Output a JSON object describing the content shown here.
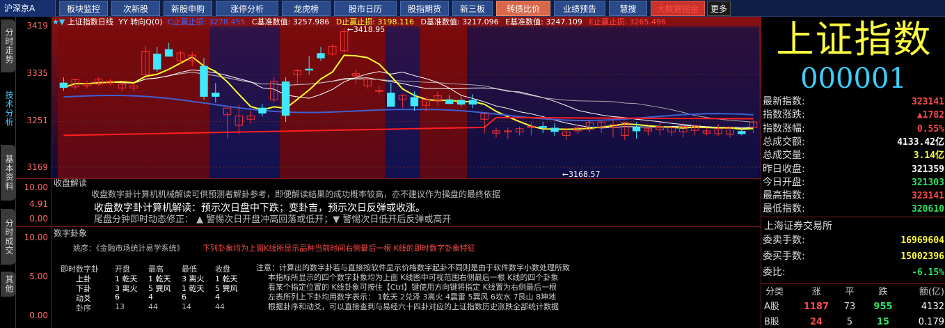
{
  "topbar": {
    "market": "沪深京A",
    "tabs": [
      "板块监控",
      "次新股",
      "新股申购",
      "涨停分析",
      "龙虎榜",
      "股市日历",
      "股指期货",
      "新三板",
      "转债比价",
      "业绩预告",
      "慧搜",
      "大数据掘金",
      "更多"
    ]
  },
  "leftbar": {
    "tabs": [
      "分时走势",
      "技术分析",
      "基本资料",
      "分时成交",
      "其他"
    ]
  },
  "chart": {
    "legend": {
      "title": "上证指数日线",
      "yy": "YY 转向Q(0)",
      "c_label": "C止赢止损:",
      "c_value": "3278.455",
      "c2_label": "C基准数值:",
      "c2_value": "3257.986",
      "d_label": "D止赢止损:",
      "d_value": "3198.116",
      "d2_label": "D基准数值:",
      "d2_value": "3217.096",
      "e_label": "E基准数值:",
      "e_value": "3247.109",
      "e2_label": "E止赢止损:",
      "e2_value": "3265.496"
    },
    "yticks": [
      "3419",
      "3335",
      "3251",
      "3169"
    ],
    "high_label": "3418.95",
    "low_label": "3168.57",
    "y_range": [
      3169,
      3419
    ]
  },
  "chart_data": {
    "type": "candlestick",
    "title": "上证指数日线",
    "ylim": [
      3169,
      3419
    ],
    "y_ticks": [
      3419,
      3335,
      3251,
      3169
    ],
    "annotations": [
      {
        "text": "3418.95",
        "value": 3418.95
      },
      {
        "text": "3168.57",
        "value": 3168.57
      }
    ],
    "candles": [
      {
        "o": 3320,
        "h": 3330,
        "l": 3306,
        "c": 3312
      },
      {
        "o": 3313,
        "h": 3328,
        "l": 3309,
        "c": 3326
      },
      {
        "o": 3315,
        "h": 3324,
        "l": 3310,
        "c": 3318
      },
      {
        "o": 3318,
        "h": 3330,
        "l": 3315,
        "c": 3327
      },
      {
        "o": 3320,
        "h": 3328,
        "l": 3316,
        "c": 3323
      },
      {
        "o": 3311,
        "h": 3322,
        "l": 3305,
        "c": 3318
      },
      {
        "o": 3311,
        "h": 3319,
        "l": 3305,
        "c": 3315
      },
      {
        "o": 3335,
        "h": 3387,
        "l": 3333,
        "c": 3377
      },
      {
        "o": 3372,
        "h": 3385,
        "l": 3340,
        "c": 3345
      },
      {
        "o": 3380,
        "h": 3392,
        "l": 3370,
        "c": 3368
      },
      {
        "o": 3360,
        "h": 3378,
        "l": 3355,
        "c": 3374
      },
      {
        "o": 3360,
        "h": 3375,
        "l": 3350,
        "c": 3370
      },
      {
        "o": 3350,
        "h": 3365,
        "l": 3290,
        "c": 3296
      },
      {
        "o": 3302,
        "h": 3320,
        "l": 3285,
        "c": 3296
      },
      {
        "o": 3263,
        "h": 3268,
        "l": 3221,
        "c": 3275
      },
      {
        "o": 3244,
        "h": 3281,
        "l": 3228,
        "c": 3261
      },
      {
        "o": 3255,
        "h": 3270,
        "l": 3247,
        "c": 3261
      },
      {
        "o": 3275,
        "h": 3282,
        "l": 3260,
        "c": 3266
      },
      {
        "o": 3290,
        "h": 3330,
        "l": 3285,
        "c": 3323
      },
      {
        "o": 3322,
        "h": 3330,
        "l": 3250,
        "c": 3262
      },
      {
        "o": 3335,
        "h": 3345,
        "l": 3318,
        "c": 3342
      },
      {
        "o": 3345,
        "h": 3368,
        "l": 3335,
        "c": 3344
      },
      {
        "o": 3373,
        "h": 3385,
        "l": 3360,
        "c": 3365
      },
      {
        "o": 3372,
        "h": 3390,
        "l": 3368,
        "c": 3386
      },
      {
        "o": 3378,
        "h": 3419,
        "l": 3375,
        "c": 3412
      },
      {
        "o": 3333,
        "h": 3345,
        "l": 3318,
        "c": 3337
      },
      {
        "o": 3315,
        "h": 3329,
        "l": 3310,
        "c": 3327
      },
      {
        "o": 3305,
        "h": 3315,
        "l": 3300,
        "c": 3307
      },
      {
        "o": 3302,
        "h": 3320,
        "l": 3285,
        "c": 3278
      },
      {
        "o": 3290,
        "h": 3300,
        "l": 3276,
        "c": 3298
      },
      {
        "o": 3294,
        "h": 3305,
        "l": 3270,
        "c": 3279
      },
      {
        "o": 3280,
        "h": 3295,
        "l": 3270,
        "c": 3290
      },
      {
        "o": 3288,
        "h": 3305,
        "l": 3280,
        "c": 3297
      },
      {
        "o": 3290,
        "h": 3298,
        "l": 3282,
        "c": 3283
      },
      {
        "o": 3289,
        "h": 3296,
        "l": 3278,
        "c": 3282
      },
      {
        "o": 3289,
        "h": 3300,
        "l": 3275,
        "c": 3282
      },
      {
        "o": 3255,
        "h": 3265,
        "l": 3230,
        "c": 3265
      },
      {
        "o": 3230,
        "h": 3240,
        "l": 3222,
        "c": 3234
      },
      {
        "o": 3233,
        "h": 3240,
        "l": 3220,
        "c": 3234
      },
      {
        "o": 3232,
        "h": 3242,
        "l": 3226,
        "c": 3238
      },
      {
        "o": 3240,
        "h": 3250,
        "l": 3226,
        "c": 3242
      },
      {
        "o": 3242,
        "h": 3250,
        "l": 3230,
        "c": 3240
      },
      {
        "o": 3239,
        "h": 3248,
        "l": 3225,
        "c": 3233
      },
      {
        "o": 3226,
        "h": 3240,
        "l": 3218,
        "c": 3232
      },
      {
        "o": 3234,
        "h": 3245,
        "l": 3228,
        "c": 3240
      },
      {
        "o": 3236,
        "h": 3252,
        "l": 3232,
        "c": 3249
      },
      {
        "o": 3240,
        "h": 3252,
        "l": 3230,
        "c": 3250
      },
      {
        "o": 3240,
        "h": 3253,
        "l": 3222,
        "c": 3245
      },
      {
        "o": 3226,
        "h": 3250,
        "l": 3218,
        "c": 3249
      },
      {
        "o": 3240,
        "h": 3250,
        "l": 3220,
        "c": 3234
      },
      {
        "o": 3234,
        "h": 3243,
        "l": 3226,
        "c": 3238
      },
      {
        "o": 3236,
        "h": 3250,
        "l": 3226,
        "c": 3242
      },
      {
        "o": 3232,
        "h": 3242,
        "l": 3225,
        "c": 3240
      },
      {
        "o": 3232,
        "h": 3248,
        "l": 3222,
        "c": 3242
      },
      {
        "o": 3235,
        "h": 3245,
        "l": 3226,
        "c": 3243
      },
      {
        "o": 3230,
        "h": 3240,
        "l": 3226,
        "c": 3234
      },
      {
        "o": 3229,
        "h": 3246,
        "l": 3225,
        "c": 3238
      },
      {
        "o": 3228,
        "h": 3242,
        "l": 3222,
        "c": 3241
      },
      {
        "o": 3233,
        "h": 3240,
        "l": 3226,
        "c": 3229
      },
      {
        "o": 3240,
        "h": 3253,
        "l": 3230,
        "c": 3250
      }
    ]
  },
  "panel1": {
    "title": "收盘解读",
    "yticks": [
      "10.00",
      "4.91",
      "0.00"
    ],
    "line1": "收盘数字卦计算机机械解读可供预测者解卦参考，即便解读结果的成功概率较高，亦不建议作为操盘的最终依据",
    "line2": "收盘数字卦计算机解读：预示次日盘中下跌；变卦吉，预示次日反弹或收涨。",
    "line3": "尾盘分钟即时动态修正：  ▲  警惕次日开盘冲高回落或低开；▼  警惕次日低开后反弹或高开"
  },
  "panel2": {
    "title": "数字卦象",
    "yticks": [
      "10.00",
      "5.00",
      "0.00"
    ],
    "author": "姚彦：《金融市场统计易学系统》",
    "headline": "下列卦象均为上面K线所显示品种当前时间右侧最后一根 K线的即时数字卦象特征",
    "table_header": [
      "即时数字卦",
      "开盘",
      "最高",
      "最低",
      "收盘"
    ],
    "rows": [
      {
        "name": "上卦",
        "open": "1 乾天",
        "high": "1 乾天",
        "low": "3 离火",
        "close": "1 乾天"
      },
      {
        "name": "下卦",
        "open": "3 离火",
        "high": "5 巽风",
        "low": "1 乾天",
        "close": "5 巽风"
      },
      {
        "name": "动爻",
        "open": "6",
        "high": "4",
        "low": "6",
        "close": "4"
      },
      {
        "name": "卦序",
        "open": "13",
        "high": "44",
        "low": "14",
        "close": "44"
      }
    ],
    "notes": [
      "注意：计算出的数字卦若与直接按软件显示价格数字起卦不同则是由于软件数字小数处理所致",
      "本指标所显示的四个数字卦象均为上面 K线图中可视范围右侧最后一根 K线的四个卦象",
      "看某个指定位置的 K线卦象可按住【Ctrl】键使用方向键将指定 K线置为右侧最后一根",
      "左表所列上下卦均用数字表示：  1乾天 2兑泽 3离火 4震雷 5巽风 6坎水 7艮山 8坤地",
      "根据卦序和动爻，可以直接查到与易经六十四卦对应的上证指数历史涨跌全部统计数据"
    ]
  },
  "right": {
    "name": "上证指数",
    "code": "000001",
    "rows": [
      {
        "label": "最新指数:",
        "value": "323141",
        "color": "#ff4a4a"
      },
      {
        "label": "指数涨跌:",
        "value": "▲1782",
        "color": "#ff4a4a"
      },
      {
        "label": "指数涨幅:",
        "value": "0.55%",
        "color": "#ff4a4a"
      },
      {
        "label": "总成交额:",
        "value": "4133.42亿",
        "color": "#ffffff"
      },
      {
        "label": "总成交量:",
        "value": "3.14亿",
        "color": "#ffff40"
      },
      {
        "label": "昨日收盘:",
        "value": "321359",
        "color": "#ffffff"
      },
      {
        "label": "今日开盘:",
        "value": "321303",
        "color": "#30e060"
      },
      {
        "label": "最高指数:",
        "value": "323141",
        "color": "#ff4a4a"
      },
      {
        "label": "最低指数:",
        "value": "320610",
        "color": "#30e060"
      }
    ],
    "exchange": "上海证券交易所",
    "rows2": [
      {
        "label": "委卖手数:",
        "value": "16969604",
        "color": "#ffff40"
      },
      {
        "label": "委买手数:",
        "value": "15002396",
        "color": "#ffff40"
      },
      {
        "label": "委比:",
        "value": "-6.15%",
        "color": "#30e060"
      }
    ],
    "table_header": [
      "分类",
      "涨",
      "平",
      "跌",
      "额(亿)"
    ],
    "table_rows": [
      {
        "cat": "A股",
        "up": "1187",
        "flat": "73",
        "down": "955",
        "amt": "4132"
      },
      {
        "cat": "B股",
        "up": "24",
        "flat": "5",
        "down": "15",
        "amt": "0.179"
      }
    ]
  }
}
